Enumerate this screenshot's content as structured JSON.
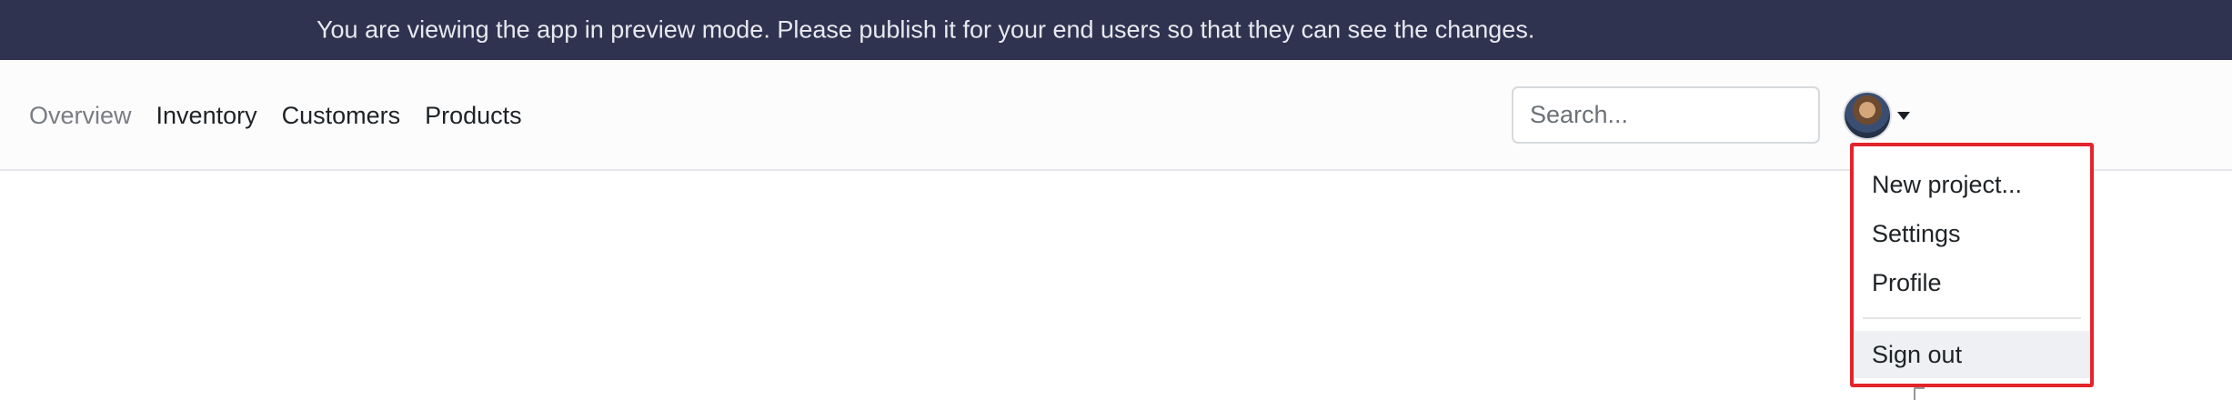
{
  "banner": {
    "text": "You are viewing the app in preview mode. Please publish it for your end users so that they can see the changes."
  },
  "nav": {
    "links": [
      {
        "label": "Overview",
        "active": true
      },
      {
        "label": "Inventory"
      },
      {
        "label": "Customers"
      },
      {
        "label": "Products"
      }
    ]
  },
  "search": {
    "placeholder": "Search...",
    "value": ""
  },
  "user_menu": {
    "avatar_icon": "user-avatar",
    "caret_icon": "caret-down-icon",
    "items": [
      {
        "label": "New project..."
      },
      {
        "label": "Settings"
      },
      {
        "label": "Profile"
      },
      {
        "label": "Sign out"
      }
    ],
    "highlight_color": "#e3242b"
  },
  "colors": {
    "banner_bg": "#2f3350",
    "navbar_bg": "#fcfcfd"
  }
}
